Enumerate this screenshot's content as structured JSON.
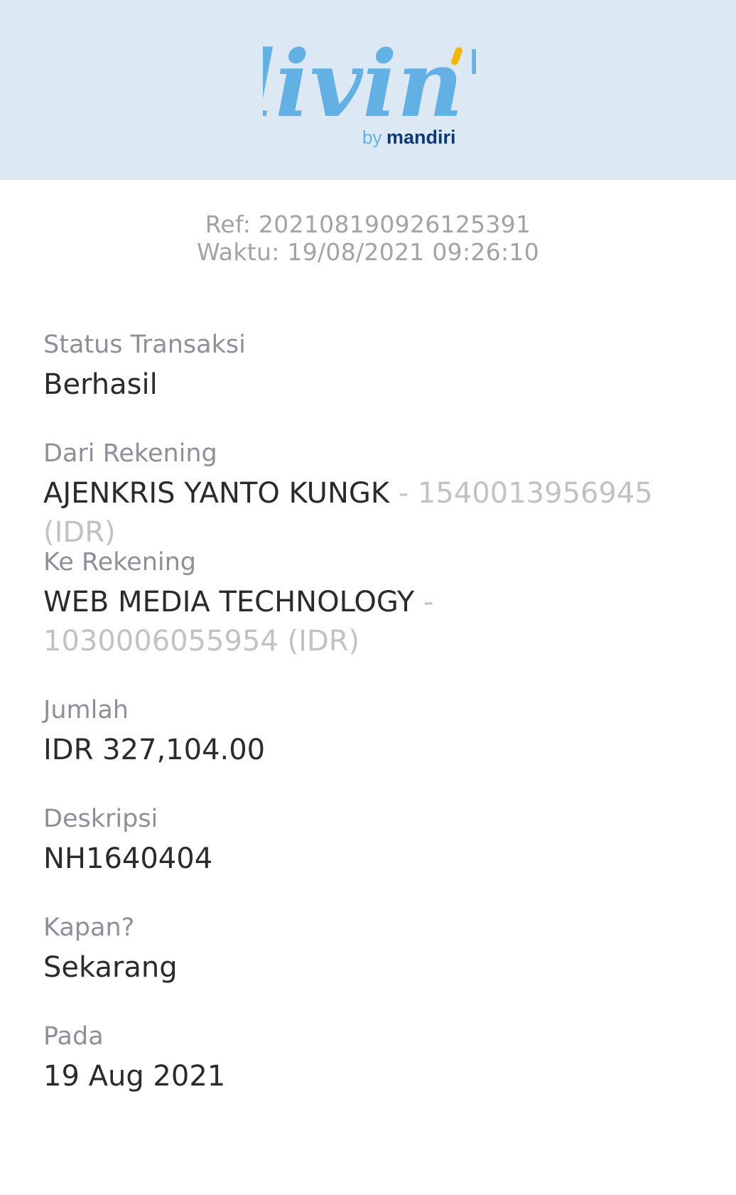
{
  "brand": {
    "logo_script": "livin'",
    "logo_by": "by",
    "logo_bank": "mandiri",
    "color_header_bg": "#dce8f3",
    "color_logo_blue": "#63b0e4",
    "color_logo_navy": "#0b3a74",
    "color_logo_accent": "#f6b600"
  },
  "receipt": {
    "ref": "Ref: 20210819092612539​1",
    "time": "Waktu: 19/08/2021 09:26:10"
  },
  "fields": {
    "status": {
      "label": "Status Transaksi",
      "value": "Berhasil"
    },
    "from": {
      "label": "Dari Rekening",
      "name": "AJENKRIS YANTO KUNGK",
      "account": " - 1540013956945 (IDR)"
    },
    "to": {
      "label": "Ke Rekening",
      "name": "WEB MEDIA TECHNOLOGY",
      "account": " - 1030006055954 (IDR)"
    },
    "amount": {
      "label": "Jumlah",
      "value": "IDR 327,104.00"
    },
    "description": {
      "label": "Deskripsi",
      "value": "NH1640404"
    },
    "when": {
      "label": "Kapan?",
      "value": "Sekarang"
    },
    "on": {
      "label": "Pada",
      "value": "19 Aug 2021"
    }
  }
}
